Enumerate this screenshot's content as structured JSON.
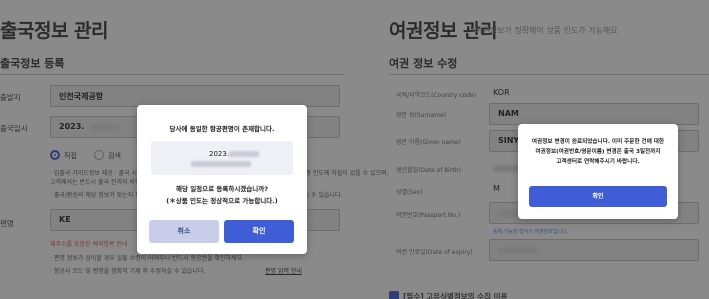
{
  "departure": {
    "title": "출국정보 관리",
    "section_title": "출국정보 등록",
    "fields": {
      "airport_label": "출발지",
      "airport_value": "인천국제공항",
      "datetime_label": "출국일시",
      "datetime_value": "2023.",
      "flight_label": "편명",
      "flight_value": "KE"
    },
    "radio": {
      "option1": "직접",
      "option2": "검색"
    },
    "notes": {
      "note1": "· 입출국 가이드정보 제공 · 출국 시간 등 상세 내용 확인 후 정확히 입력해 주세요. 정보가 다를 경우 상품 인도에 차질이 있을 수 있으며,",
      "note2": "  고객께서는 반드시 출국 전까지 비행기 정보를 확인하시기 바랍니다.",
      "note3": "· 출국/환승의 해당 정보가 맞는지 확인 후 입력해 주세요. 잘못 입력된 경우 인도 불가 및 주문 취소가 될 수 있습니다.",
      "warn": "재주소를 포함한 예외항목 안내",
      "note4": "· 편명 정보가 상이할 경우 실물 수령이 어려우니 반드시 항공권을 확인하세요.",
      "note5": "· 항공사 코드 및 편명을 정확히 기재 후 수정하실 수 있습니다.",
      "link": "편명 입력 안내"
    }
  },
  "passport": {
    "title": "여권정보 관리",
    "subtitle": "여권정보가 정확해야 상품 인도가 가능해요",
    "section_title": "여권 정보 수정",
    "fields": {
      "country_label": "국적/지역코드(Country code)",
      "country_value": "KOR",
      "surname_label": "영문 성(Surname)",
      "surname_value": "NAM",
      "givenname_label": "영문 이름(Given name)",
      "givenname_value": "SINYE",
      "birth_label": "생년월일(Date of birth)",
      "sex_label": "성별(Sex)",
      "sex_value": "M",
      "passport_no_label": "여권번호(Passport No.)",
      "expiry_label": "여권 만료일(Date of expiry)"
    },
    "passport_note": "등록 가능한 형식의 여권번호입니다.",
    "agree_label": "[필수] 고유식별정보의 수집 이용"
  },
  "modal_confirm": {
    "message": "당사에 동일한 항공편명이 존재합니다.",
    "flight_date": "2023.",
    "question": "해당 일정으로 등록하시겠습니까?",
    "notice": "(＊상품 인도는 정상적으로 가능합니다.)",
    "cancel_label": "취소",
    "confirm_label": "확인"
  },
  "modal_done": {
    "line1": "여권정보 변경이 완료되었습니다. 이미 주문한 건에 대한",
    "line2": "여권정보(여권번호/영문이름) 변경은 출국 3일전까지",
    "line3": "고객센터로 연락해주시기 바랍니다.",
    "confirm_label": "확인"
  }
}
